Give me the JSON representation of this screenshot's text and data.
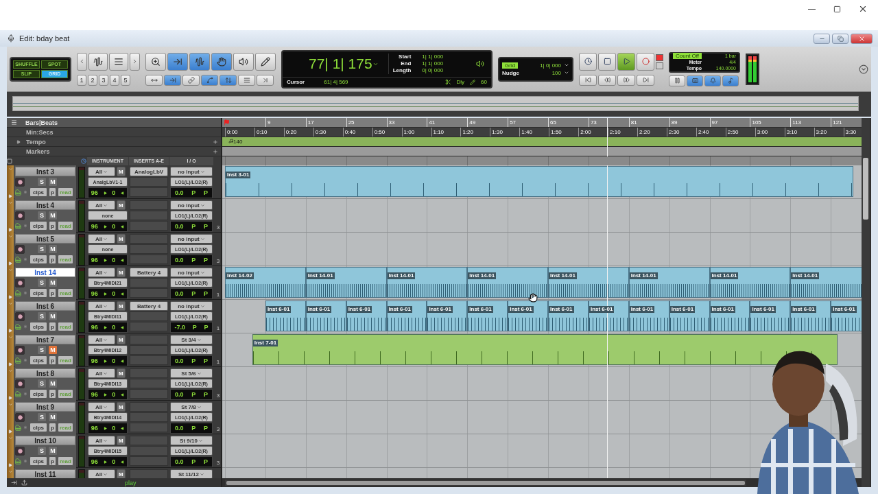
{
  "window": {
    "title": "Edit: bday beat"
  },
  "toolbar": {
    "edit_modes": [
      {
        "label": "SHUFFLE",
        "selected": false
      },
      {
        "label": "SPOT",
        "selected": false
      },
      {
        "label": "SLIP",
        "selected": false
      },
      {
        "label": "GRID",
        "selected": true
      }
    ],
    "zoom_presets": [
      "1",
      "2",
      "3",
      "4",
      "5"
    ],
    "tools": [
      {
        "kind": "zoomer",
        "selected": false
      },
      {
        "kind": "trim",
        "selected": true
      },
      {
        "kind": "selector",
        "selected": true
      },
      {
        "kind": "grabber",
        "selected": true
      },
      {
        "kind": "scrubber",
        "selected": false
      },
      {
        "kind": "pencil",
        "selected": false
      }
    ],
    "tool_options": [
      {
        "kind": "expand",
        "selected": false
      },
      {
        "kind": "insertion",
        "selected": true
      },
      {
        "kind": "link",
        "selected": false
      },
      {
        "kind": "scroll",
        "selected": true
      },
      {
        "kind": "vertical",
        "selected": true
      },
      {
        "kind": "list",
        "selected": false
      },
      {
        "kind": "lock",
        "selected": false
      }
    ],
    "counter": {
      "main": "77| 1| 175",
      "start_label": "Start",
      "end_label": "End",
      "length_label": "Length",
      "start": "1| 1| 000",
      "end": "1| 1| 000",
      "length": "0| 0| 000",
      "cursor_label": "Cursor",
      "cursor": "61| 4| 569",
      "dly_label": "Dly",
      "dly": "60"
    },
    "grid": {
      "label": "Grid",
      "value": "1| 0| 000",
      "nudge_label": "Nudge",
      "nudge_value": "100"
    },
    "transport": [
      {
        "kind": "online",
        "on": false
      },
      {
        "kind": "stop",
        "on": false
      },
      {
        "kind": "play",
        "on": true
      },
      {
        "kind": "record",
        "on": false
      }
    ],
    "locate": [
      {
        "kind": "start"
      },
      {
        "kind": "rewind"
      },
      {
        "kind": "forward"
      },
      {
        "kind": "end"
      }
    ],
    "count_off": {
      "label": "Count Off",
      "bars": "1 bar",
      "meter_label": "Meter",
      "meter": "4/4",
      "tempo_label": "Tempo",
      "tempo": "140.0000"
    },
    "midi_buttons": [
      {
        "kind": "merge",
        "selected": false
      },
      {
        "kind": "input",
        "selected": true
      },
      {
        "kind": "click",
        "selected": true
      },
      {
        "kind": "conductor",
        "selected": true
      }
    ]
  },
  "rulers": {
    "labels": [
      {
        "name": "Bars|Beats",
        "kind": "bars"
      },
      {
        "name": "Min:Secs",
        "kind": "time"
      },
      {
        "name": "Tempo",
        "kind": "tempo"
      },
      {
        "name": "Markers",
        "kind": "markers"
      }
    ],
    "bars": [
      "9",
      "17",
      "25",
      "33",
      "41",
      "49",
      "57",
      "65",
      "73",
      "81",
      "89",
      "97",
      "105",
      "113",
      "121"
    ],
    "min_secs": [
      "0:00",
      "0:10",
      "0:20",
      "0:30",
      "0:40",
      "0:50",
      "1:00",
      "1:10",
      "1:20",
      "1:30",
      "1:40",
      "1:50",
      "2:00",
      "2:10",
      "2:20",
      "2:30",
      "2:40",
      "2:50",
      "3:00",
      "3:10",
      "3:20",
      "3:30"
    ],
    "tempo": "140"
  },
  "columns": [
    "INSTRUMENT",
    "INSERTS A-E",
    "I / O"
  ],
  "tracks": [
    {
      "name": "Inst 3",
      "selected": false,
      "muted": false,
      "solo_label": "S",
      "mute_label": "M",
      "clips_label": "clps",
      "p_label": "p",
      "automation": "read",
      "input": "All",
      "midi_mute": "M",
      "midi_out": "AnalgLbV1-1",
      "velocity": "96",
      "transpose": "0",
      "insert": "AnalogLbV",
      "io_in": "no input",
      "io_out": "LO1(L)/LO2(R)",
      "volume": "0.0",
      "pan_l": "P",
      "pan_r": "P",
      "clips": [
        {
          "name": "Inst 3-01",
          "kind": "whole",
          "color": "#8fc6da"
        }
      ]
    },
    {
      "name": "Inst 4",
      "selected": false,
      "muted": false,
      "solo_label": "S",
      "mute_label": "M",
      "clips_label": "clps",
      "p_label": "p",
      "automation": "read",
      "input": "All",
      "midi_mute": "M",
      "midi_out": "none",
      "velocity": "96",
      "transpose": "0",
      "io_in": "no input",
      "io_out": "LO1(L)/LO2(R)",
      "volume": "0.0",
      "pan_l": "P",
      "pan_r": "P",
      "voice": "3"
    },
    {
      "name": "Inst 5",
      "selected": false,
      "muted": false,
      "solo_label": "S",
      "mute_label": "M",
      "clips_label": "clps",
      "p_label": "p",
      "automation": "read",
      "input": "All",
      "midi_mute": "M",
      "midi_out": "none",
      "velocity": "96",
      "transpose": "0",
      "io_in": "no input",
      "io_out": "LO1(L)/LO2(R)",
      "volume": "0.0",
      "pan_l": "P",
      "pan_r": "P",
      "voice": "3"
    },
    {
      "name": "Inst 14",
      "selected": true,
      "muted": false,
      "solo_label": "S",
      "mute_label": "M",
      "clips_label": "clps",
      "p_label": "p",
      "automation": "read",
      "input": "All",
      "midi_mute": "M",
      "midi_out": "Btry4MIDI21",
      "velocity": "96",
      "transpose": "0",
      "insert": "Battery 4",
      "io_in": "no input",
      "io_out": "LO1(L)/LO2(R)",
      "volume": "0.0",
      "pan_l": "P",
      "pan_r": "P",
      "voice": "1",
      "clips": [
        {
          "name": "Inst 14-02",
          "kind": "loop16",
          "color": "#8fc6da"
        },
        {
          "name": "Inst 14-01",
          "kind": "loop16",
          "color": "#8fc6da"
        },
        {
          "name": "Inst 14-01",
          "kind": "loop16",
          "color": "#8fc6da"
        },
        {
          "name": "Inst 14-01",
          "kind": "loop16",
          "color": "#8fc6da"
        },
        {
          "name": "Inst 14-01",
          "kind": "loop16",
          "color": "#8fc6da"
        },
        {
          "name": "Inst 14-01",
          "kind": "loop16",
          "color": "#8fc6da"
        },
        {
          "name": "Inst 14-01",
          "kind": "loop16",
          "color": "#8fc6da"
        },
        {
          "name": "Inst 14-01",
          "kind": "loop16",
          "color": "#8fc6da"
        }
      ]
    },
    {
      "name": "Inst 6",
      "selected": false,
      "muted": false,
      "solo_label": "S",
      "mute_label": "M",
      "clips_label": "clps",
      "p_label": "p",
      "automation": "read",
      "input": "All",
      "midi_mute": "M",
      "midi_out": "Btry4MIDI11",
      "velocity": "96",
      "transpose": "0",
      "insert": "Battery 4",
      "io_in": "no input",
      "io_out": "LO1(L)/LO2(R)",
      "volume": "-7.0",
      "pan_l": "P",
      "pan_r": "P",
      "voice": "1",
      "clips": [
        {
          "name": "Inst 6-01",
          "kind": "loop8",
          "color": "#8fc6da"
        },
        {
          "name": "Inst 6-01",
          "kind": "loop8",
          "color": "#8fc6da"
        },
        {
          "name": "Inst 6-01",
          "kind": "loop8",
          "color": "#8fc6da"
        },
        {
          "name": "Inst 6-01",
          "kind": "loop8",
          "color": "#8fc6da"
        },
        {
          "name": "Inst 6-01",
          "kind": "loop8",
          "color": "#8fc6da"
        },
        {
          "name": "Inst 6-01",
          "kind": "loop8",
          "color": "#8fc6da"
        },
        {
          "name": "Inst 6-01",
          "kind": "loop8",
          "color": "#8fc6da"
        },
        {
          "name": "Inst 6-01",
          "kind": "loop8",
          "color": "#8fc6da"
        },
        {
          "name": "Inst 6-01",
          "kind": "loop8",
          "color": "#8fc6da"
        },
        {
          "name": "Inst 6-01",
          "kind": "loop8",
          "color": "#8fc6da"
        },
        {
          "name": "Inst 6-01",
          "kind": "loop8",
          "color": "#8fc6da"
        },
        {
          "name": "Inst 6-01",
          "kind": "loop8",
          "color": "#8fc6da"
        },
        {
          "name": "Inst 6-01",
          "kind": "loop8",
          "color": "#8fc6da"
        },
        {
          "name": "Inst 6-01",
          "kind": "loop8",
          "color": "#8fc6da"
        },
        {
          "name": "Inst 6-01",
          "kind": "loop8",
          "color": "#8fc6da"
        }
      ]
    },
    {
      "name": "Inst 7",
      "selected": false,
      "muted": true,
      "solo_label": "S",
      "mute_label": "M",
      "clips_label": "clps",
      "p_label": "p",
      "automation": "read",
      "input": "All",
      "midi_mute": "M",
      "midi_out": "Btry4MIDI12",
      "velocity": "96",
      "transpose": "0",
      "io_in": "St 3/4",
      "io_out": "LO1(L)/LO2(R)",
      "volume": "0.0",
      "pan_l": "P",
      "pan_r": "P",
      "voice": "1",
      "clips": [
        {
          "name": "Inst 7-01",
          "kind": "late",
          "color": "#9dcb6c"
        }
      ]
    },
    {
      "name": "Inst 8",
      "selected": false,
      "muted": false,
      "solo_label": "S",
      "mute_label": "M",
      "clips_label": "clps",
      "p_label": "p",
      "automation": "read",
      "input": "All",
      "midi_mute": "M",
      "midi_out": "Btry4MIDI13",
      "velocity": "96",
      "transpose": "0",
      "io_in": "St 5/6",
      "io_out": "LO1(L)/LO2(R)",
      "volume": "0.0",
      "pan_l": "P",
      "pan_r": "P",
      "voice": "3"
    },
    {
      "name": "Inst 9",
      "selected": false,
      "muted": false,
      "solo_label": "S",
      "mute_label": "M",
      "clips_label": "clps",
      "p_label": "p",
      "automation": "read",
      "input": "All",
      "midi_mute": "M",
      "midi_out": "Btry4MIDI14",
      "velocity": "96",
      "transpose": "0",
      "io_in": "St 7/8",
      "io_out": "LO1(L)/LO2(R)",
      "volume": "0.0",
      "pan_l": "P",
      "pan_r": "P",
      "voice": "3"
    },
    {
      "name": "Inst 10",
      "selected": false,
      "muted": false,
      "solo_label": "S",
      "mute_label": "M",
      "clips_label": "clps",
      "p_label": "p",
      "automation": "read",
      "input": "All",
      "midi_mute": "M",
      "midi_out": "Btry4MIDI15",
      "velocity": "96",
      "transpose": "0",
      "io_in": "St 9/10",
      "io_out": "LO1(L)/LO2(R)",
      "volume": "0.0",
      "pan_l": "P",
      "pan_r": "P",
      "voice": "3"
    },
    {
      "name": "Inst 11",
      "selected": false,
      "input": "All",
      "midi_mute": "M",
      "io_in": "St 11/12"
    }
  ],
  "status": {
    "mode": "play"
  }
}
